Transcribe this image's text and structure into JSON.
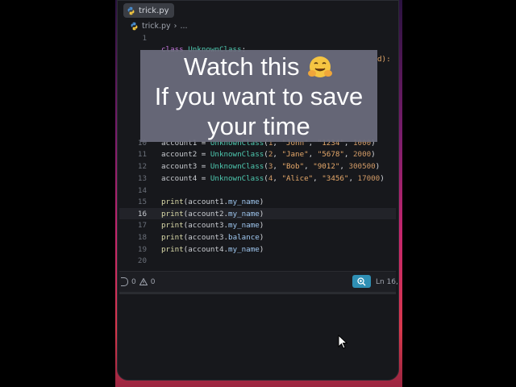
{
  "tab": {
    "filename": "trick.py"
  },
  "breadcrumb": {
    "file": "trick.py",
    "more": "..."
  },
  "lines": [
    {
      "n": "1",
      "code": ""
    },
    {
      "n": "2",
      "code": "class UnknownClass:"
    },
    {
      "n": "10",
      "code": "account1 = UnknownClass(1, \"John\", \"1234\", 1000)"
    },
    {
      "n": "11",
      "code": "account2 = UnknownClass(2, \"Jane\", \"5678\", 2000)"
    },
    {
      "n": "12",
      "code": "account3 = UnknownClass(3, \"Bob\", \"9012\", 300500)"
    },
    {
      "n": "13",
      "code": "account4 = UnknownClass(4, \"Alice\", \"3456\", 17000)"
    },
    {
      "n": "14",
      "code": ""
    },
    {
      "n": "15",
      "code": "print(account1.my_name)"
    },
    {
      "n": "16",
      "code": "print(account2.my_name)"
    },
    {
      "n": "17",
      "code": "print(account3.my_name)"
    },
    {
      "n": "18",
      "code": "print(account3.balance)"
    },
    {
      "n": "19",
      "code": "print(account4.my_name)"
    },
    {
      "n": "20",
      "code": ""
    }
  ],
  "hidden_fragment": "d):",
  "status": {
    "errors": "0",
    "warnings": "0",
    "position": "Ln 16,"
  },
  "overlay": {
    "line1": "Watch this",
    "line2": "If you want to save",
    "line3": "your time"
  },
  "colors": {
    "accent": "#2f8fb4",
    "keyword": "#c678dd",
    "class": "#4ec9b0",
    "string": "#e5a86a"
  }
}
